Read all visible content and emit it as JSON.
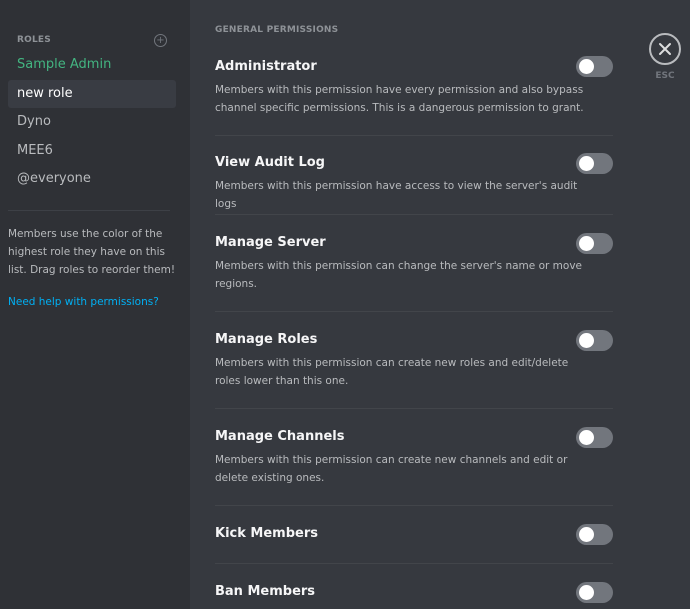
{
  "sidebar": {
    "roles_title": "ROLES",
    "add_icon": "plus-circle-icon",
    "roles": [
      {
        "label": "Sample Admin",
        "color": "#43b581"
      },
      {
        "label": "new role",
        "selected": true
      },
      {
        "label": "Dyno"
      },
      {
        "label": "MEE6"
      },
      {
        "label": "@everyone"
      }
    ],
    "hint": "Members use the color of the highest role they have on this list. Drag roles to reorder them!",
    "help_link": "Need help with permissions?"
  },
  "main": {
    "section_title": "GENERAL PERMISSIONS",
    "permissions": [
      {
        "name": "Administrator",
        "description": "Members with this permission have every permission and also bypass channel specific permissions. This is a dangerous permission to grant.",
        "enabled": false
      },
      {
        "name": "View Audit Log",
        "description": "Members with this permission have access to view the server's audit logs",
        "enabled": false
      },
      {
        "name": "Manage Server",
        "description": "Members with this permission can change the server's name or move regions.",
        "enabled": false
      },
      {
        "name": "Manage Roles",
        "description": "Members with this permission can create new roles and edit/delete roles lower than this one.",
        "enabled": false
      },
      {
        "name": "Manage Channels",
        "description": "Members with this permission can create new channels and edit or delete existing ones.",
        "enabled": false
      },
      {
        "name": "Kick Members",
        "description": "",
        "enabled": false
      },
      {
        "name": "Ban Members",
        "description": "",
        "enabled": false
      }
    ]
  },
  "close": {
    "icon": "close-icon",
    "label": "ESC"
  },
  "colors": {
    "background": "#36393f",
    "sidebar": "#2f3136",
    "link": "#00b0f4",
    "toggle_off": "#72767d"
  }
}
